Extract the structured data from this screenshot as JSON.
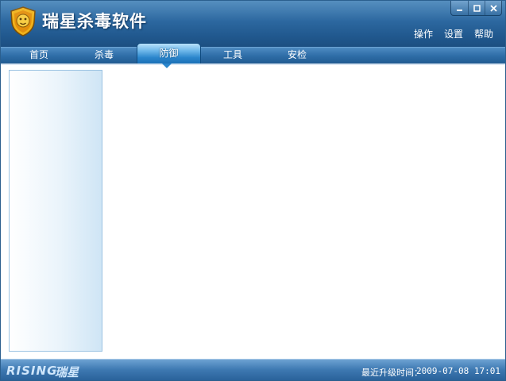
{
  "app": {
    "title": "瑞星杀毒软件"
  },
  "window_buttons": [
    "minimize-icon",
    "maximize-icon",
    "close-icon"
  ],
  "top_menu": [
    {
      "label": "操作"
    },
    {
      "label": "设置"
    },
    {
      "label": "帮助"
    }
  ],
  "tabs": [
    {
      "label": "首页",
      "active": false
    },
    {
      "label": "杀毒",
      "active": false
    },
    {
      "label": "防御",
      "active": true
    },
    {
      "label": "工具",
      "active": false
    },
    {
      "label": "安检",
      "active": false
    }
  ],
  "status": {
    "brand_en": "RISING",
    "brand_cn": "瑞星",
    "update_label": "最近升级时间：",
    "update_time": "2009-07-08 17:01"
  },
  "colors": {
    "titlebar": "#2e6aa2",
    "tab_active": "#2b86cc",
    "statusbar": "#3e79b2",
    "logo_gold": "#f0b21a"
  }
}
